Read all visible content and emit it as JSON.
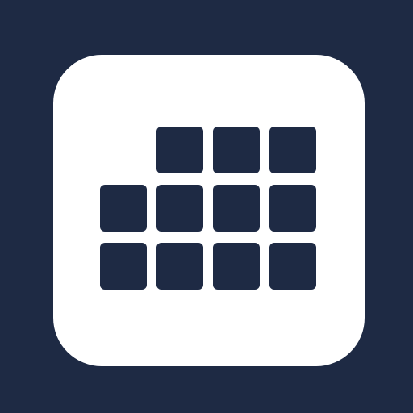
{
  "colors": {
    "background": "#1e2a44",
    "icon_tile": "#ffffff",
    "cell": "#1e2a44"
  },
  "icon": {
    "name": "calendar-grid-icon",
    "rows": [
      {
        "filled": [
          false,
          true,
          true,
          true
        ]
      },
      {
        "filled": [
          true,
          true,
          true,
          true
        ]
      },
      {
        "filled": [
          true,
          true,
          true,
          true
        ]
      }
    ]
  }
}
